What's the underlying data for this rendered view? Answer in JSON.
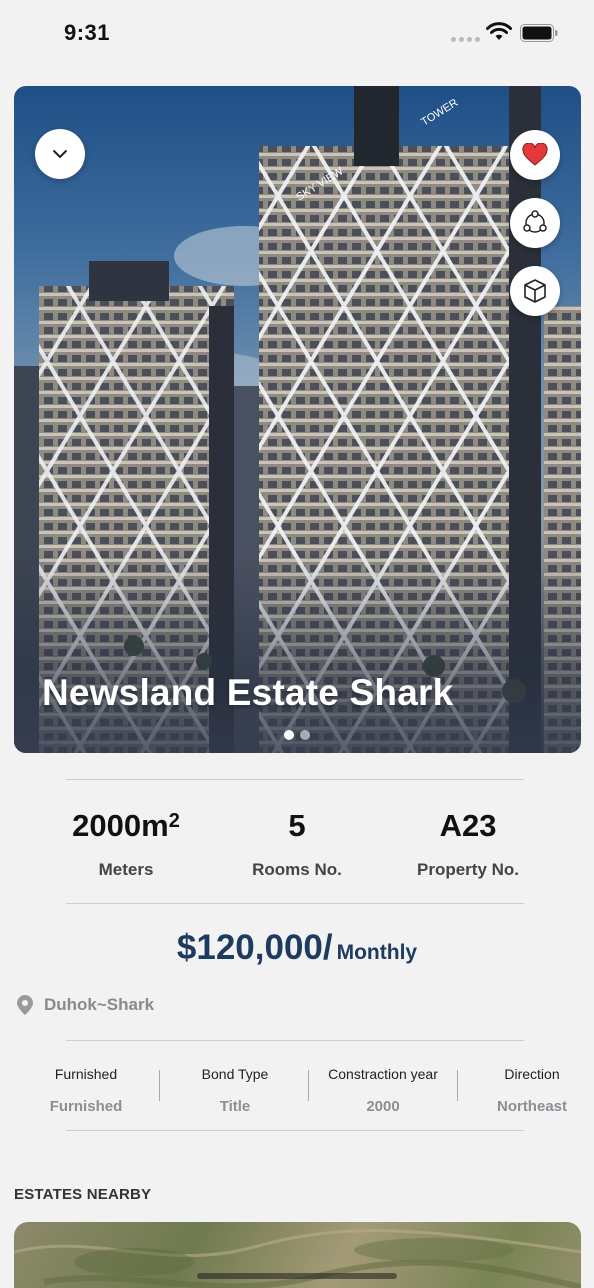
{
  "status_bar": {
    "time": "9:31"
  },
  "hero": {
    "title": "Newsland Estate Shark",
    "building_text_1": "SKY VIEW",
    "building_text_2": "TOWER",
    "page_count": 2,
    "active_page": 1
  },
  "stats": [
    {
      "value": "2000m",
      "superscript": "2",
      "label": "Meters"
    },
    {
      "value": "5",
      "superscript": "",
      "label": "Rooms No."
    },
    {
      "value": "A23",
      "superscript": "",
      "label": "Property No."
    }
  ],
  "price": {
    "amount": "$120,000/",
    "period": "Monthly"
  },
  "location": {
    "text": "Duhok~Shark"
  },
  "details": [
    {
      "label": "Furnished",
      "value": "Furnished"
    },
    {
      "label": "Bond Type",
      "value": "Title"
    },
    {
      "label": "Constraction year",
      "value": "2000"
    },
    {
      "label": "Direction",
      "value": "Northeast"
    }
  ],
  "sections": {
    "nearby_title": "ESTATES NEARBY"
  },
  "icons": {
    "collapse": "chevron-down-icon",
    "favorite": "heart-icon",
    "share": "share-icon",
    "model": "cube-icon"
  },
  "colors": {
    "favorite": "#e5383b",
    "price": "#1d3a5f",
    "muted": "#8a8f96"
  }
}
